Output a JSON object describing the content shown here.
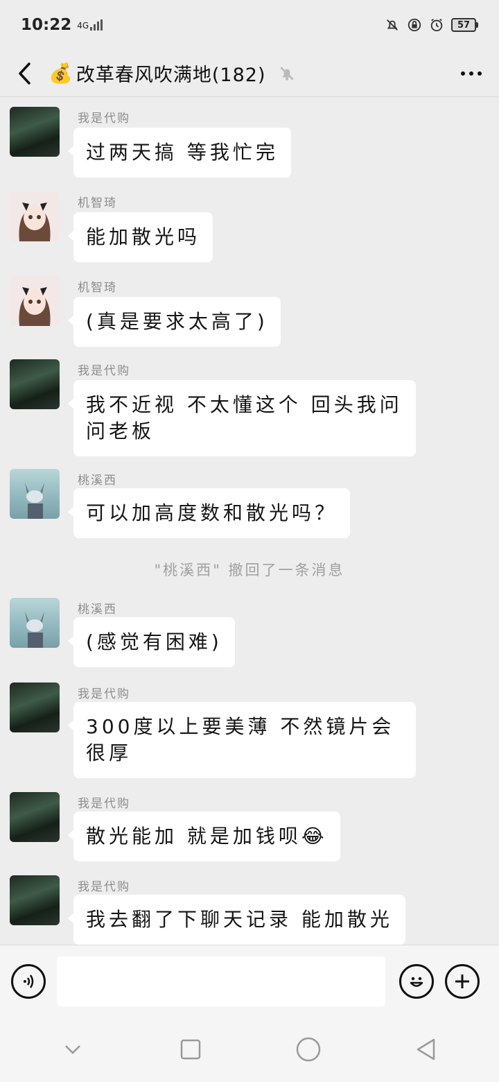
{
  "status_bar": {
    "time": "10:22",
    "network": "4G",
    "battery": "57"
  },
  "header": {
    "title_icon": "money-bag-emoji",
    "title": "改革春风吹满地(182)",
    "muted_icon": "bell-off-icon",
    "more_icon": "more-icon"
  },
  "messages": [
    {
      "sender": "我是代购",
      "avatar": "dark-avatar",
      "text": "过两天搞 等我忙完"
    },
    {
      "sender": "机智琦",
      "avatar": "girl-avatar",
      "text": "能加散光吗"
    },
    {
      "sender": "机智琦",
      "avatar": "girl-avatar",
      "text": "(真是要求太高了)"
    },
    {
      "sender": "我是代购",
      "avatar": "dark-avatar",
      "text": "我不近视 不太懂这个 回头我问问老板"
    },
    {
      "sender": "桃溪西",
      "avatar": "tom-cat-avatar",
      "text": "可以加高度数和散光吗？"
    },
    {
      "sender": "桃溪西",
      "avatar": "tom-cat-avatar",
      "text": "(感觉有困难)"
    },
    {
      "sender": "我是代购",
      "avatar": "dark-avatar",
      "text": "300度以上要美薄 不然镜片会很厚"
    },
    {
      "sender": "我是代购",
      "avatar": "dark-avatar",
      "text": "散光能加 就是加钱呗😂"
    },
    {
      "sender": "我是代购",
      "avatar": "dark-avatar",
      "text": "我去翻了下聊天记录 能加散光"
    }
  ],
  "system_notice": "\"桃溪西\" 撤回了一条消息",
  "input_bar": {
    "voice_icon": "voice-icon",
    "emoji_icon": "emoji-icon",
    "plus_icon": "plus-icon"
  }
}
